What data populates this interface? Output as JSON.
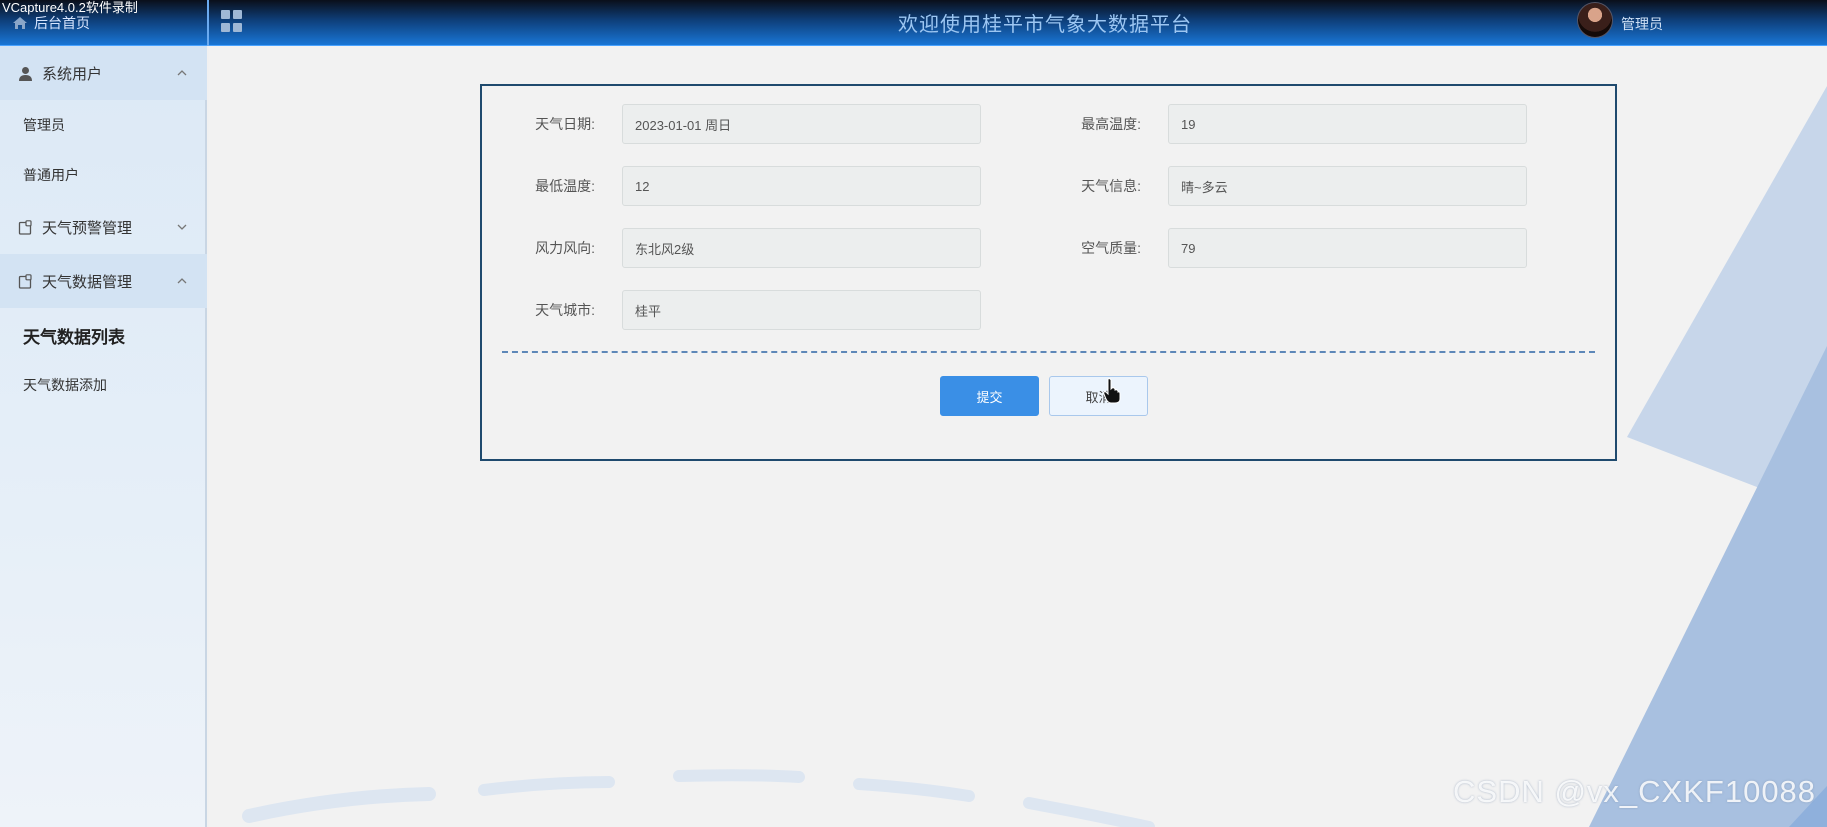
{
  "recorder_watermark": "VCapture4.0.2软件录制",
  "header": {
    "home_label": "后台首页",
    "title": "欢迎使用桂平市气象大数据平台",
    "user_name": "管理员"
  },
  "sidebar": {
    "groups": [
      {
        "label": "系统用户",
        "icon": "user-icon",
        "expanded": true,
        "items": [
          "管理员",
          "普通用户"
        ]
      },
      {
        "label": "天气预警管理",
        "icon": "notebook-icon",
        "expanded": false,
        "items": []
      },
      {
        "label": "天气数据管理",
        "icon": "notebook-icon",
        "expanded": true,
        "items": [
          "天气数据列表",
          "天气数据添加"
        ],
        "active_item": "天气数据列表"
      }
    ]
  },
  "form": {
    "fields": [
      {
        "label": "天气日期:",
        "value": "2023-01-01 周日"
      },
      {
        "label": "最高温度:",
        "value": "19"
      },
      {
        "label": "最低温度:",
        "value": "12"
      },
      {
        "label": "天气信息:",
        "value": "晴~多云"
      },
      {
        "label": "风力风向:",
        "value": "东北风2级"
      },
      {
        "label": "空气质量:",
        "value": "79"
      },
      {
        "label": "天气城市:",
        "value": "桂平"
      }
    ],
    "submit_label": "提交",
    "cancel_label": "取消"
  },
  "footer_watermark": "CSDN @vx_CXKF10088",
  "colors": {
    "primary_button": "#3a8fe6",
    "header_gradient_top": "#0a0f1a",
    "header_gradient_bottom": "#1976d6",
    "card_border": "#1f4a6e"
  }
}
